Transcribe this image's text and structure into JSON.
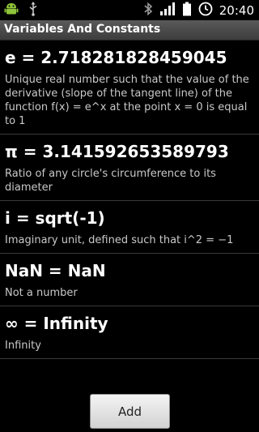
{
  "status_bar": {
    "time": "20:40",
    "icons": [
      "android-icon",
      "usb-icon",
      "bluetooth-icon",
      "signal-icon",
      "battery-icon",
      "alarm-icon"
    ]
  },
  "title_bar": {
    "title": "Variables And Constants"
  },
  "items": [
    {
      "name": "e = 2.718281828459045",
      "description": "Unique real number such that the value of the derivative (slope of the tangent line) of the function f(x) = e^x at the point x = 0 is equal to 1"
    },
    {
      "name": "π = 3.141592653589793",
      "description": "Ratio of any circle's circumference to its diameter"
    },
    {
      "name": "i = sqrt(-1)",
      "description": "Imaginary unit, defined such that i^2 = −1"
    },
    {
      "name": "NaN = NaN",
      "description": "Not a number"
    },
    {
      "name": "∞ = Infinity",
      "description": "Infinity"
    }
  ],
  "actions": {
    "add_label": "Add"
  }
}
